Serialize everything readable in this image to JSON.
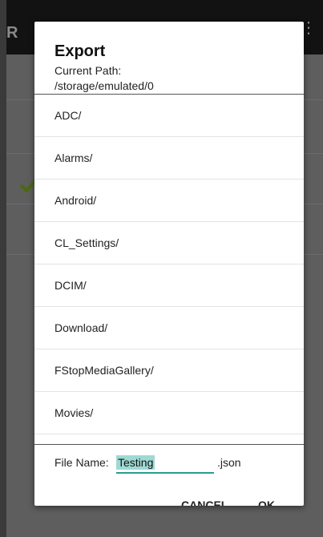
{
  "app": {
    "title_initial": "R",
    "menu_glyph": "⋮"
  },
  "dialog": {
    "title": "Export",
    "path_label": "Current Path:",
    "path_value": "/storage/emulated/0",
    "folders": [
      {
        "label": "ADC/"
      },
      {
        "label": "Alarms/"
      },
      {
        "label": "Android/"
      },
      {
        "label": "CL_Settings/"
      },
      {
        "label": "DCIM/"
      },
      {
        "label": "Download/"
      },
      {
        "label": "FStopMediaGallery/"
      },
      {
        "label": "Movies/"
      }
    ],
    "file_name_label": "File Name:",
    "file_name_value": "Testing",
    "file_extension": ".json",
    "cancel_label": "CANCEL",
    "ok_label": "OK"
  },
  "colors": {
    "accent": "#2a9d8f",
    "selection": "#9fd9d3",
    "check": "#4a6a12"
  }
}
